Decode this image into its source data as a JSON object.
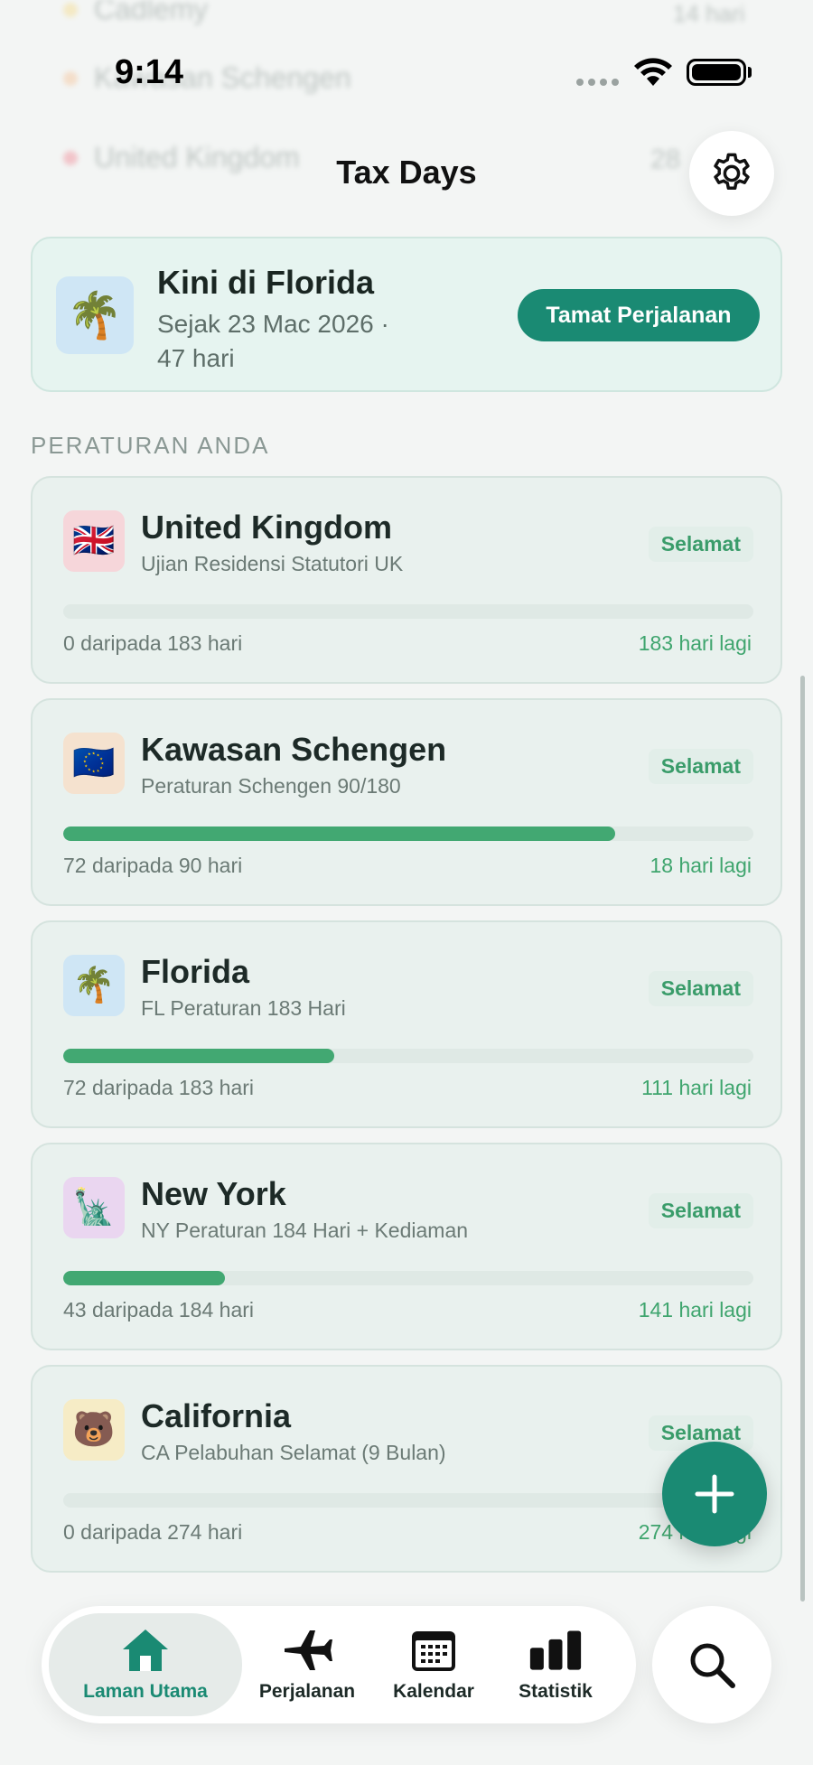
{
  "status_bar": {
    "time": "9:14"
  },
  "background_rows": [
    {
      "name": "Cadlemy",
      "value": "14 hari",
      "dot": "#f5d36a"
    },
    {
      "name": "Kawasan Schengen",
      "value": "",
      "dot": "#f6b37a"
    },
    {
      "name": "United Kingdom",
      "value": "28",
      "dot": "#ef6a7a"
    }
  ],
  "header": {
    "title": "Tax Days"
  },
  "current_trip": {
    "title": "Kini di Florida",
    "subtitle": "Sejak 23 Mac 2026 · 47 hari",
    "end_button": "Tamat Perjalanan",
    "flag": "🌴"
  },
  "section_label": "PERATURAN ANDA",
  "rules": [
    {
      "flag": "🇬🇧",
      "flag_bg": "#f6d6da",
      "name": "United Kingdom",
      "desc": "Ujian Residensi Statutori UK",
      "status": "Selamat",
      "used": "0 daripada 183 hari",
      "left": "183 hari lagi",
      "progress": 0
    },
    {
      "flag": "🇪🇺",
      "flag_bg": "#f5e2cf",
      "name": "Kawasan Schengen",
      "desc": "Peraturan Schengen 90/180",
      "status": "Selamat",
      "used": "72 daripada 90 hari",
      "left": "18 hari lagi",
      "progress": 0.8
    },
    {
      "flag": "🌴",
      "flag_bg": "#cfe6f5",
      "name": "Florida",
      "desc": "FL Peraturan 183 Hari",
      "status": "Selamat",
      "used": "72 daripada 183 hari",
      "left": "111 hari lagi",
      "progress": 0.393
    },
    {
      "flag": "🗽",
      "flag_bg": "#ead6f0",
      "name": "New York",
      "desc": "NY Peraturan 184 Hari + Kediaman",
      "status": "Selamat",
      "used": "43 daripada 184 hari",
      "left": "141 hari lagi",
      "progress": 0.234
    },
    {
      "flag": "🐻",
      "flag_bg": "#f6ecc6",
      "name": "California",
      "desc": "CA Pelabuhan Selamat (9 Bulan)",
      "status": "Selamat",
      "used": "0 daripada 274 hari",
      "left": "274 hari lagi",
      "progress": 0
    }
  ],
  "nav": {
    "home": "Laman Utama",
    "trips": "Perjalanan",
    "calendar": "Kalendar",
    "stats": "Statistik"
  },
  "colors": {
    "accent": "#1a8a73",
    "safe": "#42a872"
  }
}
